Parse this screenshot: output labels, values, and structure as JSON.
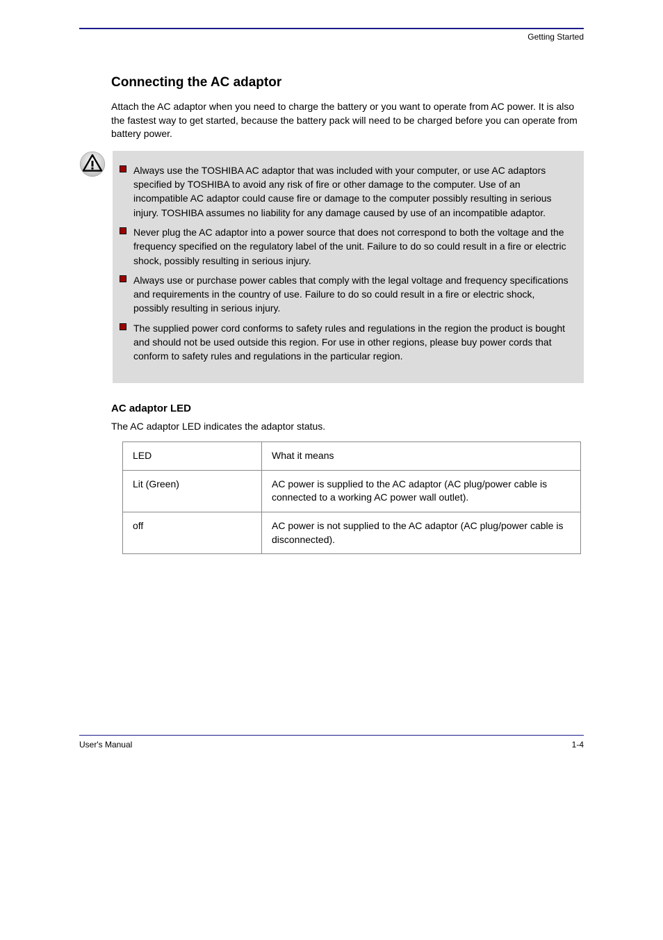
{
  "header": {
    "label": "Getting Started"
  },
  "section": {
    "title": "Connecting the AC adaptor",
    "intro": "Attach the AC adaptor when you need to charge the battery or you want to operate from AC power. It is also the fastest way to get started, because the battery pack will need to be charged before you can operate from battery power."
  },
  "callout": {
    "items": [
      "Always use the TOSHIBA AC adaptor that was included with your computer, or use AC adaptors specified by TOSHIBA to avoid any risk of fire or other damage to the computer. Use of an incompatible AC adaptor could cause fire or damage to the computer possibly resulting in serious injury. TOSHIBA assumes no liability for any damage caused by use of an incompatible adaptor.",
      "Never plug the AC adaptor into a power source that does not correspond to both the voltage and the frequency specified on the regulatory label of the unit. Failure to do so could result in a fire or electric shock, possibly resulting in serious injury.",
      "Always use or purchase power cables that comply with the legal voltage and frequency specifications and requirements in the country of use. Failure to do so could result in a fire or electric shock, possibly resulting in serious injury.",
      "The supplied power cord conforms to safety rules and regulations in the region the product is bought and should not be used outside this region. For use in other regions, please buy power cords that conform to safety rules and regulations in the particular region."
    ]
  },
  "sub": {
    "title": "AC adaptor LED",
    "text": "The AC adaptor LED indicates the adaptor status."
  },
  "table": {
    "rows": [
      {
        "c1": "LED",
        "c2": "What it means"
      },
      {
        "c1": "Lit (Green)",
        "c2": "AC power is supplied to the AC adaptor (AC plug/power cable is connected to a working AC power wall outlet)."
      },
      {
        "c1": "off",
        "c2": "AC power is not supplied to the AC adaptor (AC plug/power cable is disconnected)."
      }
    ]
  },
  "footer": {
    "left": "User's Manual",
    "right": "1-4"
  }
}
